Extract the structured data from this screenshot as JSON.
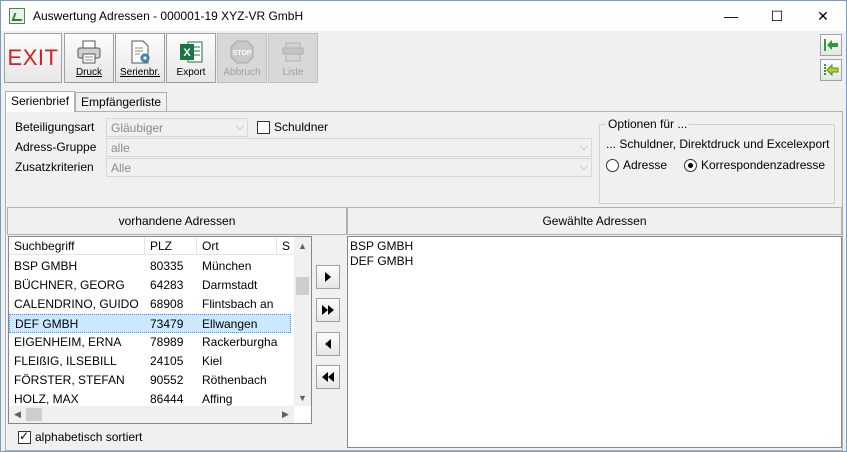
{
  "window": {
    "title": "Auswertung Adressen - 000001-19 XYZ-VR GmbH",
    "minimize": "—",
    "maximize": "☐",
    "close": "✕"
  },
  "toolbar": {
    "exit": "EXIT",
    "druck": "Druck",
    "serienbr": "Serienbr.",
    "export": "Export",
    "abbruch": "Abbruch",
    "liste": "Liste",
    "stop_text": "STOP"
  },
  "tabs": [
    "Serienbrief",
    "Empfängerliste"
  ],
  "form": {
    "beteiligungsart_label": "Beteiligungsart",
    "beteiligungsart_value": "Gläubiger",
    "schuldner_label": "Schuldner",
    "adressgruppe_label": "Adress-Gruppe",
    "adressgruppe_value": "alle",
    "zusatzkriterien_label": "Zusatzkriterien",
    "zusatzkriterien_value": "Alle"
  },
  "optionen": {
    "title": "Optionen für ...",
    "description": "... Schuldner, Direktdruck und Excelexport",
    "radio_adresse": "Adresse",
    "radio_korrespondenz": "Korrespondenzadresse"
  },
  "available": {
    "header": "vorhandene Adressen",
    "columns": [
      "Suchbegriff",
      "PLZ",
      "Ort",
      "S"
    ],
    "rows": [
      [
        "BSP GMBH",
        "80335",
        "München"
      ],
      [
        "BÜCHNER, GEORG",
        "64283",
        "Darmstadt"
      ],
      [
        "CALENDRINO, GUIDO",
        "68908",
        "Flintsbach an"
      ],
      [
        "DEF GMBH",
        "73479",
        "Ellwangen"
      ],
      [
        "EIGENHEIM, ERNA",
        "78989",
        "Rackerburgha"
      ],
      [
        "FLEIßIG, ILSEBILL",
        "24105",
        "Kiel"
      ],
      [
        "FÖRSTER, STEFAN",
        "90552",
        "Röthenbach"
      ],
      [
        "HOLZ, MAX",
        "86444",
        "Affing"
      ]
    ],
    "selected_index": 3,
    "sorted_label": "alphabetisch sortiert"
  },
  "chosen": {
    "header": "Gewählte Adressen",
    "items": [
      "BSP GMBH",
      "DEF GMBH"
    ]
  },
  "colors": {
    "exit_red": "#d42020",
    "selection": "#cce8ff",
    "excel_green": "#1f7244",
    "nav_green": "#2e9a3a"
  }
}
